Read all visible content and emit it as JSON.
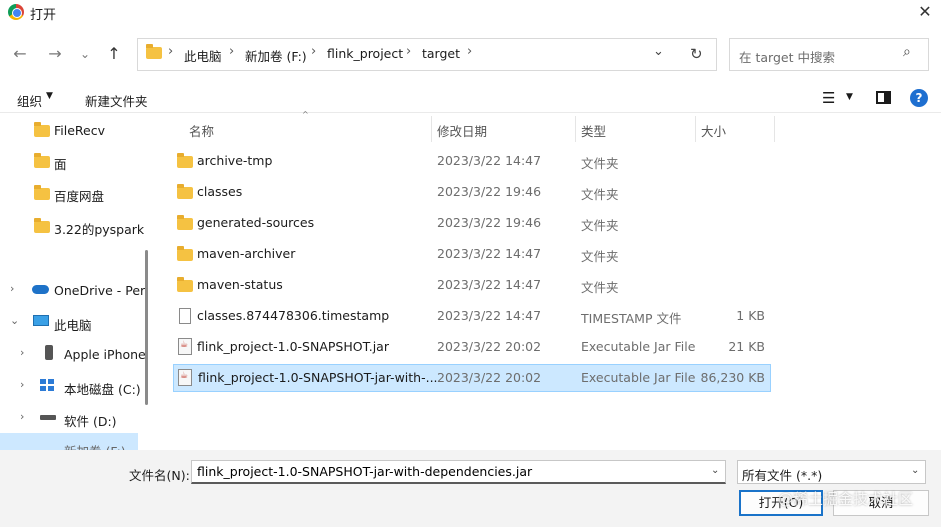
{
  "window": {
    "title": "打开",
    "close_symbol": "✕"
  },
  "nav": {
    "back": "←",
    "forward": "→",
    "recent": "⌄",
    "up": "↑"
  },
  "address": {
    "crumbs": [
      "此电脑",
      "新加卷 (F:)",
      "flink_project",
      "target"
    ],
    "separator": "›",
    "dropdown": "⌄",
    "refresh": "↻"
  },
  "search": {
    "placeholder": "在 target 中搜索",
    "icon": "⌕"
  },
  "toolbar": {
    "organize": "组织",
    "organize_caret": "▼",
    "new_folder": "新建文件夹",
    "view_icon": "☰",
    "view_caret": "▼",
    "help": "?"
  },
  "sidebar": {
    "items": [
      {
        "label": "FileRecv",
        "icon": "folder-icon"
      },
      {
        "label": "面",
        "icon": "folder-icon"
      },
      {
        "label": "百度网盘",
        "icon": "folder-icon"
      },
      {
        "label": "3.22的pyspark",
        "icon": "folder-icon"
      },
      {
        "label": "OneDrive - Per",
        "icon": "cloud-icon",
        "chevron": "›"
      },
      {
        "label": "此电脑",
        "icon": "computer-icon",
        "chevron": "⌄"
      },
      {
        "label": "Apple iPhone",
        "icon": "phone-icon",
        "chevron": "›"
      },
      {
        "label": "本地磁盘 (C:)",
        "icon": "drive-icon",
        "chevron": "›"
      },
      {
        "label": "软件 (D:)",
        "icon": "drive-icon",
        "chevron": "›"
      },
      {
        "label": "新加卷 (F:)",
        "icon": "drive-icon",
        "chevron": "›"
      }
    ]
  },
  "columns": {
    "name": "名称",
    "modified": "修改日期",
    "type": "类型",
    "size": "大小",
    "sort_caret": "^"
  },
  "files": [
    {
      "name": "archive-tmp",
      "date": "2023/3/22 14:47",
      "type": "文件夹",
      "size": "",
      "kind": "folder"
    },
    {
      "name": "classes",
      "date": "2023/3/22 19:46",
      "type": "文件夹",
      "size": "",
      "kind": "folder"
    },
    {
      "name": "generated-sources",
      "date": "2023/3/22 19:46",
      "type": "文件夹",
      "size": "",
      "kind": "folder"
    },
    {
      "name": "maven-archiver",
      "date": "2023/3/22 14:47",
      "type": "文件夹",
      "size": "",
      "kind": "folder"
    },
    {
      "name": "maven-status",
      "date": "2023/3/22 14:47",
      "type": "文件夹",
      "size": "",
      "kind": "folder"
    },
    {
      "name": "classes.874478306.timestamp",
      "date": "2023/3/22 14:47",
      "type": "TIMESTAMP 文件",
      "size": "1 KB",
      "kind": "file"
    },
    {
      "name": "flink_project-1.0-SNAPSHOT.jar",
      "date": "2023/3/22 20:02",
      "type": "Executable Jar File",
      "size": "21 KB",
      "kind": "jar"
    },
    {
      "name": "flink_project-1.0-SNAPSHOT-jar-with-...",
      "date": "2023/3/22 20:02",
      "type": "Executable Jar File",
      "size": "86,230 KB",
      "kind": "jar",
      "selected": true
    }
  ],
  "footer": {
    "filename_label": "文件名(N):",
    "filename_value": "flink_project-1.0-SNAPSHOT-jar-with-dependencies.jar",
    "filename_caret": "⌄",
    "filter_value": "所有文件 (*.*)",
    "filter_caret": "⌄",
    "open_label": "打开(O)",
    "cancel_label": "取消",
    "watermark": "@稀土掘金技术社区"
  }
}
